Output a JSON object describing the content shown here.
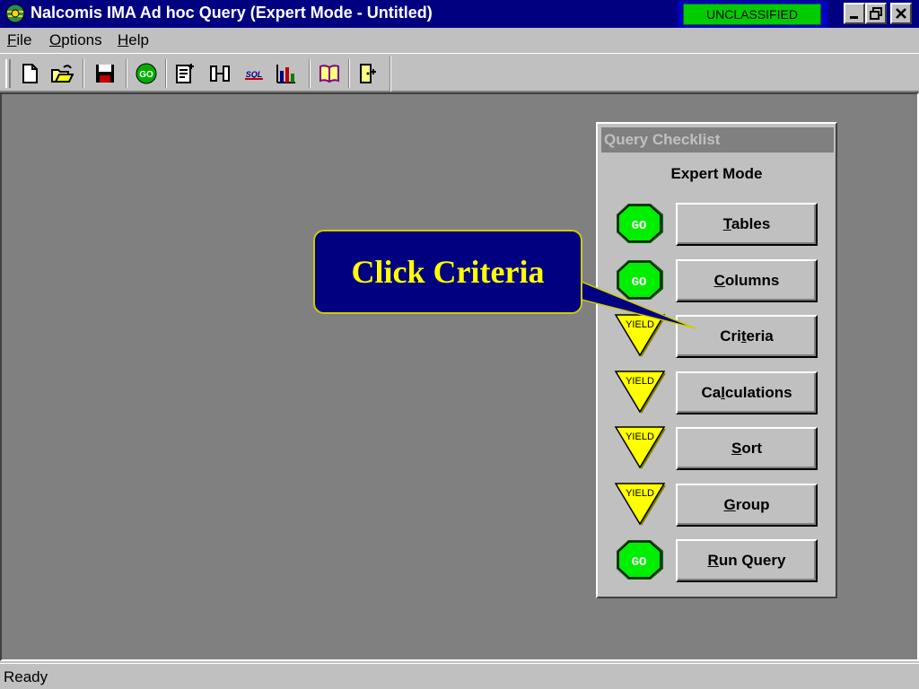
{
  "window": {
    "title": "Nalcomis IMA Ad hoc Query (Expert Mode - Untitled)",
    "classification": "UNCLASSIFIED",
    "colors": {
      "titlebar": "#000080",
      "classification_badge": "#00cc00",
      "face": "#c0c0c0",
      "client": "#808080"
    }
  },
  "menu": [
    {
      "key": "F",
      "rest": "ile"
    },
    {
      "key": "O",
      "rest": "ptions"
    },
    {
      "key": "H",
      "rest": "elp"
    }
  ],
  "toolbar": {
    "icons": [
      "new-document-icon",
      "open-folder-icon",
      "save-disk-icon",
      "go-icon",
      "edit-sheet-icon",
      "join-icon",
      "sql-icon",
      "chart-icon",
      "book-icon",
      "exit-door-icon"
    ],
    "go_label": "GO",
    "sql_label": "SQL"
  },
  "checklist": {
    "title": "Query Checklist",
    "mode": "Expert Mode",
    "go_sign": "GO",
    "yield_sign": "YIELD",
    "items": [
      {
        "pre": "",
        "key": "T",
        "post": "ables",
        "status": "go"
      },
      {
        "pre": "",
        "key": "C",
        "post": "olumns",
        "status": "go"
      },
      {
        "pre": "Cri",
        "key": "t",
        "post": "eria",
        "status": "yield"
      },
      {
        "pre": "Ca",
        "key": "l",
        "post": "culations",
        "status": "yield"
      },
      {
        "pre": "",
        "key": "S",
        "post": "ort",
        "status": "yield"
      },
      {
        "pre": "",
        "key": "G",
        "post": "roup",
        "status": "yield"
      },
      {
        "pre": "",
        "key": "R",
        "post": "un Query",
        "status": "go"
      }
    ],
    "colors": {
      "go": "#00ee00",
      "yield": "#ffff00"
    }
  },
  "callout": {
    "text": "Click Criteria",
    "colors": {
      "fill": "#000080",
      "text": "#ffff00"
    }
  },
  "status": {
    "text": "Ready"
  }
}
